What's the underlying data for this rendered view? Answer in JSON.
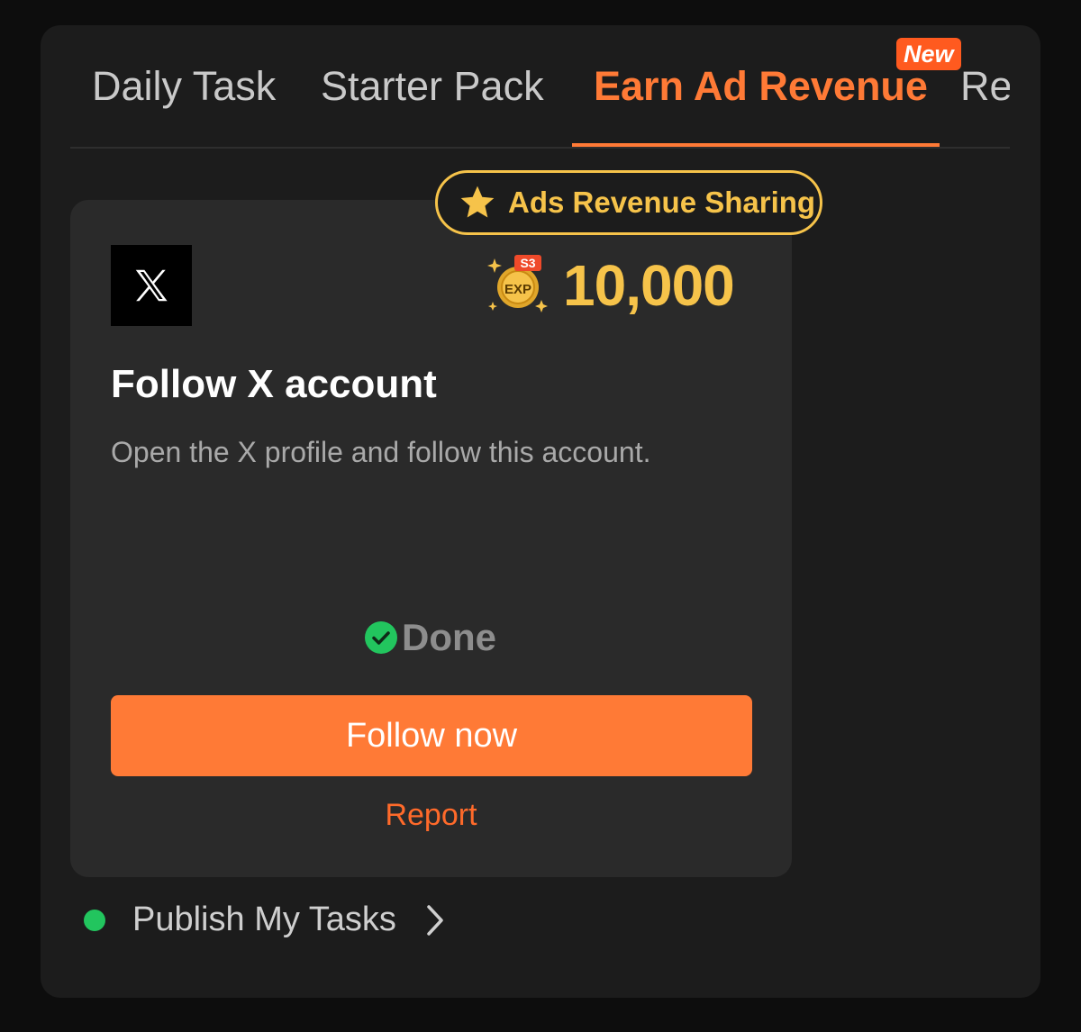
{
  "tabs": [
    {
      "label": "Daily Task"
    },
    {
      "label": "Starter Pack"
    },
    {
      "label": "Earn Ad Revenue",
      "active": true,
      "badge": "New"
    },
    {
      "label": "Re"
    }
  ],
  "card": {
    "badge": "Ads Revenue Sharing",
    "platform_icon": "x-logo-icon",
    "reward": {
      "season": "S3",
      "unit": "EXP",
      "value": "10,000"
    },
    "title": "Follow X account",
    "description": "Open the X profile and follow this account.",
    "status": "Done",
    "button_label": "Follow now",
    "report_label": "Report"
  },
  "footer": {
    "publish_label": "Publish My Tasks"
  },
  "colors": {
    "accent": "#ff7a36",
    "gold": "#f6c34a",
    "success": "#22c55e",
    "card_bg": "#2a2a2a",
    "panel_bg": "#1c1c1c"
  }
}
